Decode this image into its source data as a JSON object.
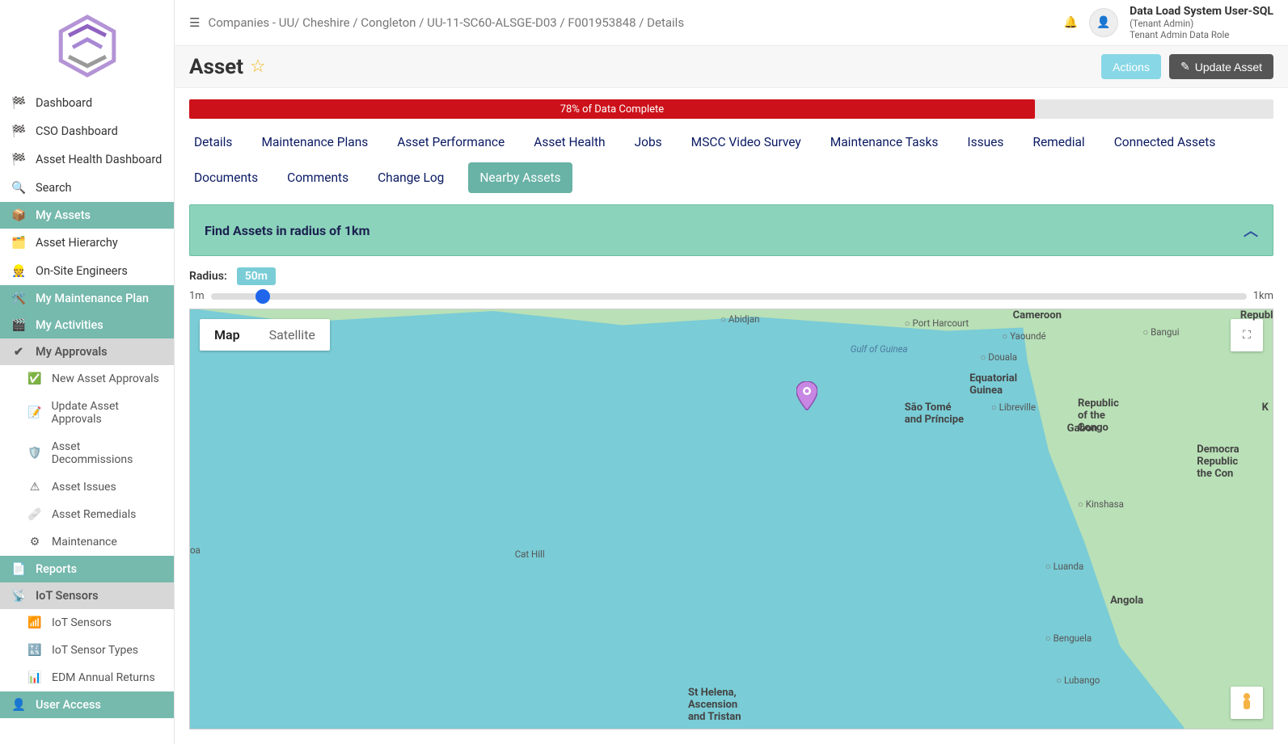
{
  "breadcrumb": "Companies - UU/ Cheshire / Congleton / UU-11-SC60-ALSGE-D03 / F001953848 / Details",
  "user": {
    "name": "Data Load System User-SQL",
    "role1": "(Tenant Admin)",
    "role2": "Tenant Admin Data Role"
  },
  "title": "Asset",
  "actions": {
    "actions": "Actions",
    "update": "Update Asset"
  },
  "progress": {
    "pct": 78,
    "label": "78% of Data Complete"
  },
  "tabs": {
    "row1": [
      "Details",
      "Maintenance Plans",
      "Asset Performance",
      "Asset Health",
      "Jobs",
      "MSCC Video Survey",
      "Maintenance Tasks",
      "Issues",
      "Remedial",
      "Connected Assets",
      "Documents"
    ],
    "row2": [
      "Comments",
      "Change Log",
      "Nearby Assets"
    ],
    "active": "Nearby Assets"
  },
  "panel": {
    "title": "Find Assets in radius of 1km"
  },
  "radius": {
    "label": "Radius:",
    "value": "50m",
    "min": "1m",
    "max": "1km",
    "pct": 5
  },
  "map": {
    "types": {
      "map": "Map",
      "satellite": "Satellite",
      "selected": "Map"
    },
    "labels": {
      "gulf": "Gulf of Guinea",
      "abidjan": "Abidjan",
      "portHarcourt": "Port Harcourt",
      "cameroon": "Cameroon",
      "yaounde": "Yaoundé",
      "bangui": "Bangui",
      "douala": "Douala",
      "eqGuinea": "Equatorial\nGuinea",
      "saoTome": "São Tomé\nand Príncipe",
      "libreville": "Libreville",
      "gabon": "Gabon",
      "roc": "Republic\nof the\nCongo",
      "drc": "Democra\nRepublic\nthe Con",
      "kinshasa": "Kinshasa",
      "catHill": "Cat Hill",
      "luanda": "Luanda",
      "angola": "Angola",
      "benguela": "Benguela",
      "lubango": "Lubango",
      "stHelena": "St Helena,\nAscension\nand Tristan",
      "oa": "oa",
      "republic": "Republic",
      "k": "K"
    }
  },
  "sidebar": {
    "items_top": [
      "Dashboard",
      "CSO Dashboard",
      "Asset Health Dashboard",
      "Search"
    ],
    "my_assets": "My Assets",
    "assets_sub": [
      "Asset Hierarchy",
      "On-Site Engineers"
    ],
    "my_maint": "My Maintenance Plan",
    "my_act": "My Activities",
    "my_appr": "My Approvals",
    "appr_sub": [
      "New Asset Approvals",
      "Update Asset Approvals",
      "Asset Decommissions",
      "Asset Issues",
      "Asset Remedials",
      "Maintenance"
    ],
    "reports": "Reports",
    "iot": "IoT Sensors",
    "iot_sub": [
      "IoT Sensors",
      "IoT Sensor Types",
      "EDM Annual Returns"
    ],
    "user_access": "User Access"
  }
}
